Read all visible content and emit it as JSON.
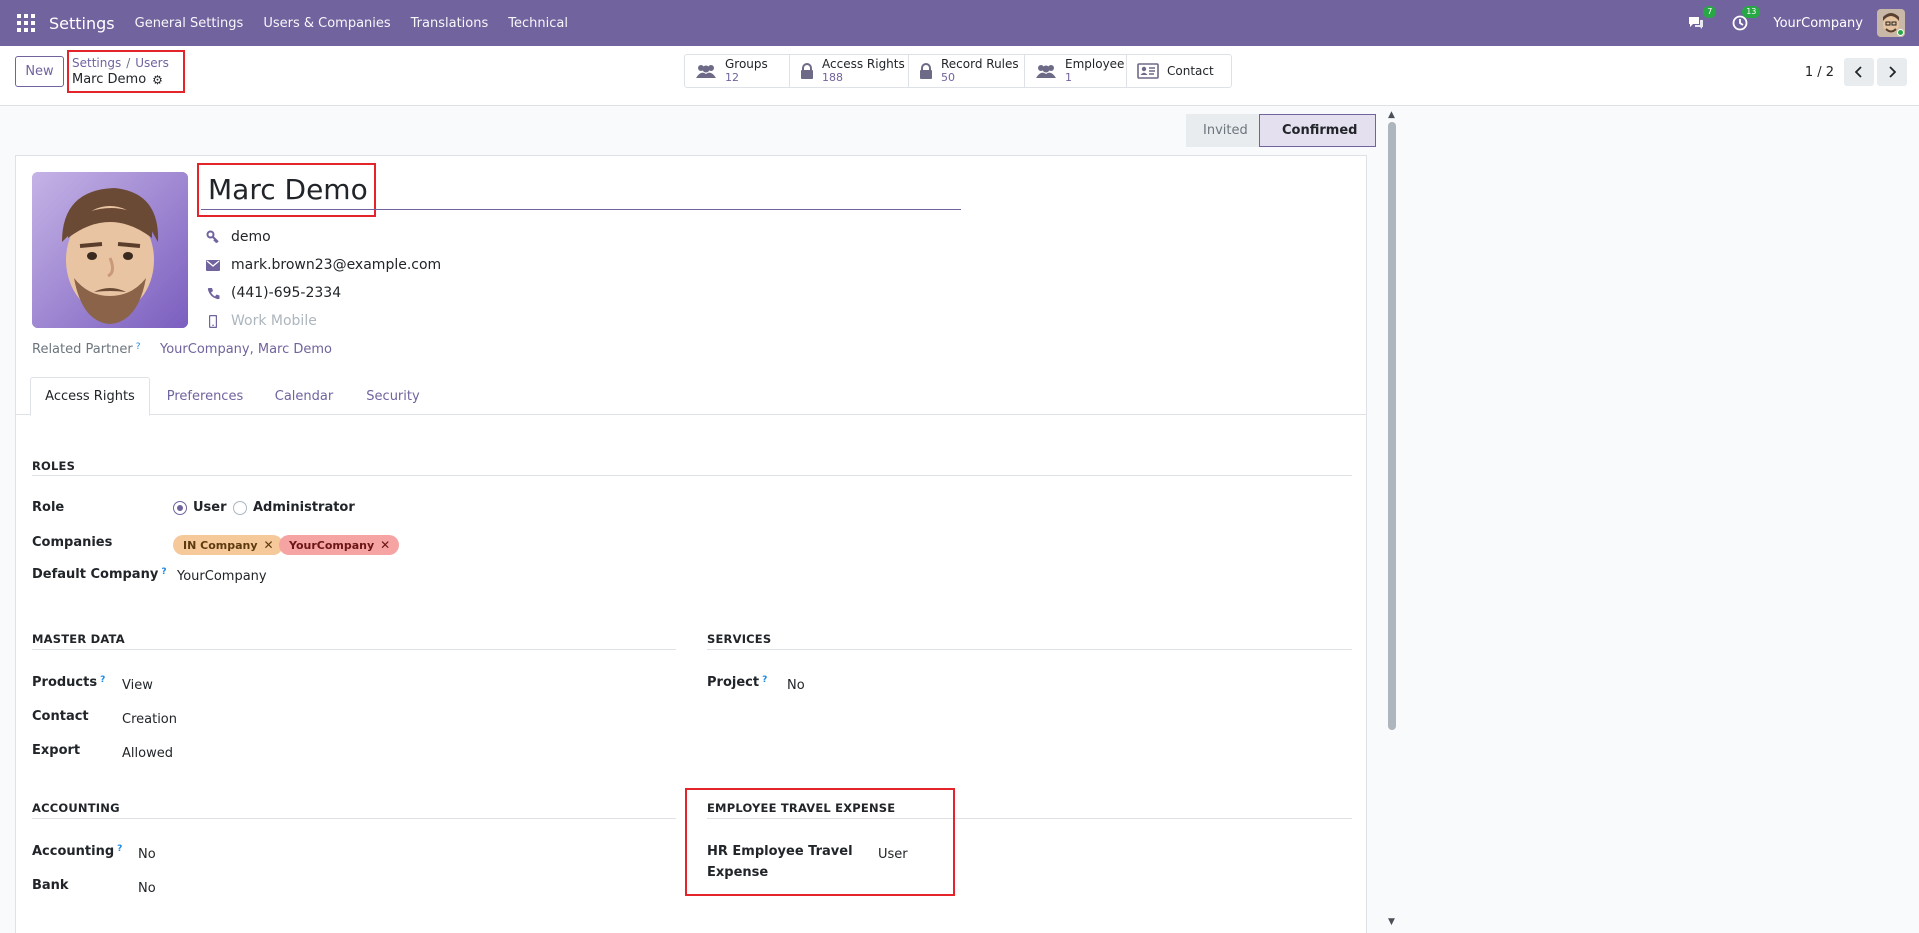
{
  "navbar": {
    "brand": "Settings",
    "menu": [
      "General Settings",
      "Users & Companies",
      "Translations",
      "Technical"
    ],
    "messages_badge": "7",
    "activities_badge": "13",
    "company": "YourCompany",
    "color": "#71639e"
  },
  "control": {
    "new_label": "New",
    "breadcrumb": {
      "root": "Settings",
      "parent": "Users",
      "current": "Marc Demo"
    },
    "smart_buttons": [
      {
        "label": "Groups",
        "value": "12",
        "icon": "users-icon"
      },
      {
        "label": "Access Rights",
        "value": "188",
        "icon": "lock-icon"
      },
      {
        "label": "Record Rules",
        "value": "50",
        "icon": "lock-icon"
      },
      {
        "label": "Employee",
        "value": "1",
        "icon": "users-icon"
      },
      {
        "label": "Contact",
        "value": "",
        "icon": "address-card-icon"
      }
    ],
    "pager": "1 / 2"
  },
  "status": {
    "steps": [
      "Invited",
      "Confirmed"
    ],
    "active": "Confirmed"
  },
  "user": {
    "name": "Marc Demo",
    "login": "demo",
    "email": "mark.brown23@example.com",
    "phone": "(441)-695-2334",
    "mobile_placeholder": "Work Mobile",
    "related_partner_label": "Related Partner",
    "related_partner": "YourCompany, Marc Demo"
  },
  "tabs": [
    "Access Rights",
    "Preferences",
    "Calendar",
    "Security"
  ],
  "roles": {
    "title": "ROLES",
    "role_label": "Role",
    "role_options": [
      "User",
      "Administrator"
    ],
    "role_selected": "User",
    "companies_label": "Companies",
    "companies": [
      "IN Company",
      "YourCompany"
    ],
    "default_company_label": "Default Company",
    "default_company": "YourCompany"
  },
  "master_data": {
    "title": "MASTER DATA",
    "fields": [
      {
        "label": "Products",
        "value": "View",
        "help": true
      },
      {
        "label": "Contact",
        "value": "Creation",
        "help": false
      },
      {
        "label": "Export",
        "value": "Allowed",
        "help": false
      }
    ]
  },
  "services": {
    "title": "SERVICES",
    "fields": [
      {
        "label": "Project",
        "value": "No",
        "help": true
      }
    ]
  },
  "accounting": {
    "title": "ACCOUNTING",
    "fields": [
      {
        "label": "Accounting",
        "value": "No",
        "help": true
      },
      {
        "label": "Bank",
        "value": "No",
        "help": false
      }
    ]
  },
  "travel_expense": {
    "title": "EMPLOYEE TRAVEL EXPENSE",
    "field_label_1": "HR Employee Travel",
    "field_label_2": "Expense",
    "field_value": "User"
  },
  "help_mark": "?"
}
